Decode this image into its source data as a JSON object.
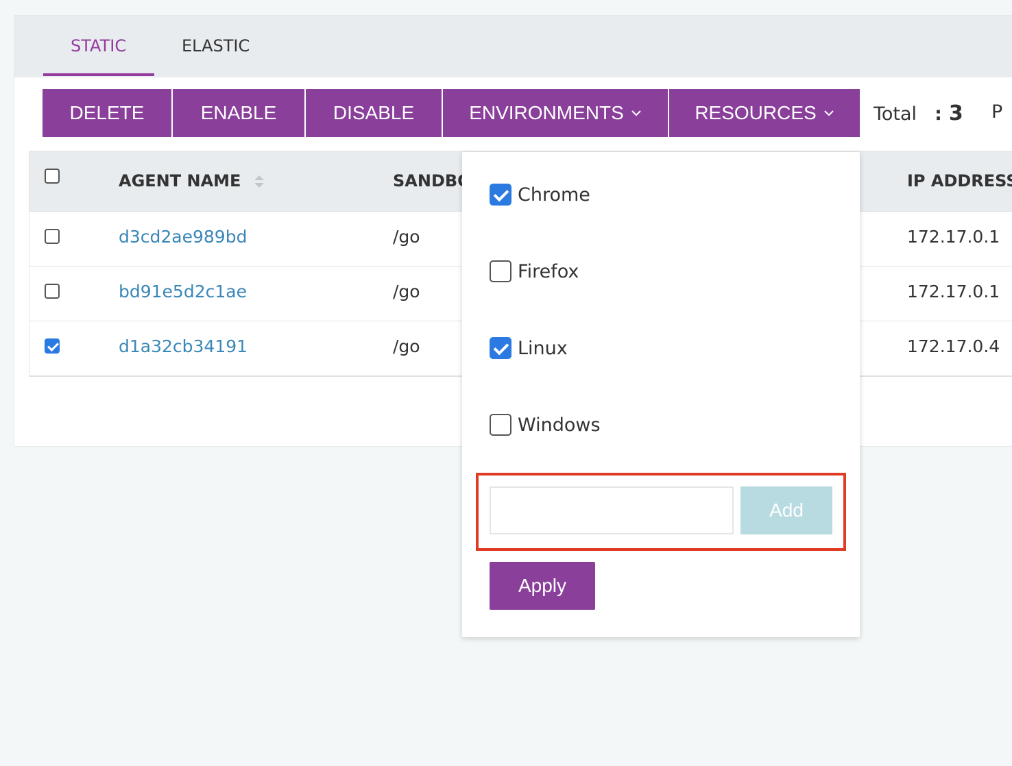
{
  "tabs": [
    {
      "label": "STATIC",
      "active": true
    },
    {
      "label": "ELASTIC",
      "active": false
    }
  ],
  "toolbar": {
    "delete_label": "DELETE",
    "enable_label": "ENABLE",
    "disable_label": "DISABLE",
    "environments_label": "ENVIRONMENTS",
    "resources_label": "RESOURCES",
    "total_label": "Total",
    "total_colon": ":",
    "total_count": "3",
    "next_label_cut": "P"
  },
  "table": {
    "headers": {
      "agent_name": "AGENT NAME",
      "sandbox_cut": "SANDBOX",
      "ip_cut": "IP ADDRESS"
    },
    "rows": [
      {
        "agent": "d3cd2ae989bd",
        "sandbox": "/go",
        "ip": "172.17.0.1",
        "checked": false
      },
      {
        "agent": "bd91e5d2c1ae",
        "sandbox": "/go",
        "ip": "172.17.0.1",
        "checked": false
      },
      {
        "agent": "d1a32cb34191",
        "sandbox": "/go",
        "ip": "172.17.0.4",
        "checked": true
      }
    ]
  },
  "environments_dropdown": {
    "options": [
      {
        "label": "Chrome",
        "checked": true
      },
      {
        "label": "Firefox",
        "checked": false
      },
      {
        "label": "Linux",
        "checked": true
      },
      {
        "label": "Windows",
        "checked": false
      }
    ],
    "new_env_value": "",
    "add_label": "Add",
    "apply_label": "Apply"
  },
  "colors": {
    "accent": "#8a3f9b",
    "active_tab": "#943b9e",
    "link": "#3a87b8",
    "checkbox_checked": "#2a7ae2",
    "add_button": "#b7dbe0",
    "highlight": "#e03b24"
  }
}
